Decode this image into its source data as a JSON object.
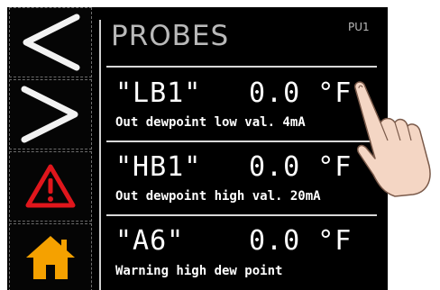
{
  "header": {
    "title": "PROBES",
    "unit_id": "PU1"
  },
  "nav": [
    {
      "icon": "chevron-left-icon"
    },
    {
      "icon": "chevron-right-icon"
    },
    {
      "icon": "warning-icon",
      "color": "#e0161c"
    },
    {
      "icon": "home-icon",
      "color": "#f5a100"
    }
  ],
  "probes": [
    {
      "name": "\"LB1\"",
      "value": "0.0 °F",
      "description": "Out dewpoint low val. 4mA"
    },
    {
      "name": "\"HB1\"",
      "value": "0.0 °F",
      "description": "Out dewpoint high val. 20mA"
    },
    {
      "name": "\"A6\"",
      "value": "0.0 °F",
      "description": "Warning high dew point"
    }
  ]
}
